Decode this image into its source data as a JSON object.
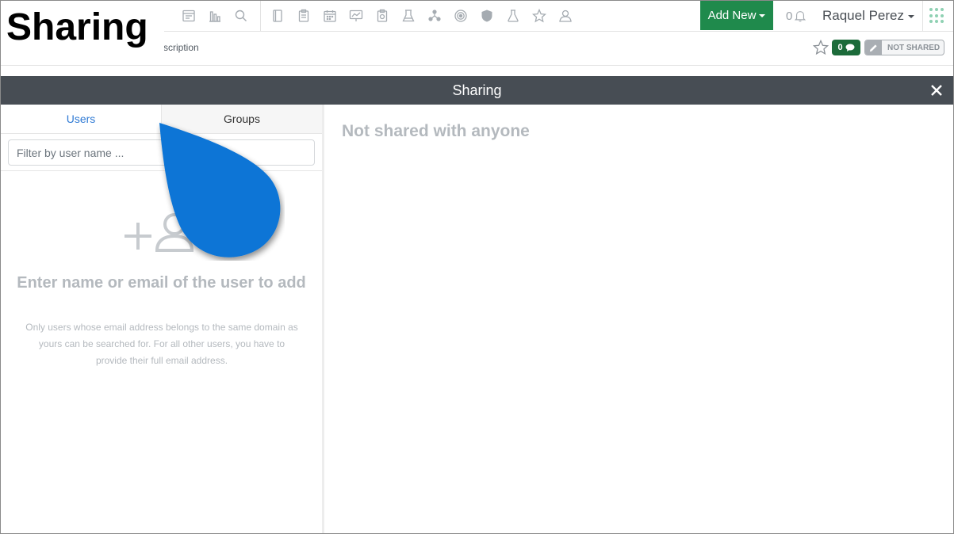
{
  "caption": "Sharing",
  "navbar": {
    "icons": [
      "dashboard-icon",
      "reports-icon",
      "search-icon",
      "notebook-icon",
      "clipboard-icon",
      "calendar-icon",
      "presentation-icon",
      "checklist-icon",
      "lab-icon",
      "network-icon",
      "target-icon",
      "shield-icon",
      "flask-icon",
      "star-icon",
      "user-icon"
    ],
    "add_new_label": "Add New",
    "notification_count": "0",
    "user_name": "Raquel Perez",
    "accent_color": "#1f8a4c"
  },
  "subheader": {
    "breadcrumb_fragment": "scription",
    "comment_count": "0",
    "share_status": "NOT SHARED"
  },
  "modal": {
    "title": "Sharing",
    "tabs": [
      {
        "label": "Users",
        "active": true
      },
      {
        "label": "Groups",
        "active": false
      }
    ],
    "filter_placeholder": "Filter by user name ...",
    "empty_title": "Enter name or email of the user to add",
    "empty_text": "Only users whose email address belongs to the same domain as yours can be searched for. For all other users, you have to provide their full email address.",
    "shared_status": "Not shared with anyone"
  }
}
